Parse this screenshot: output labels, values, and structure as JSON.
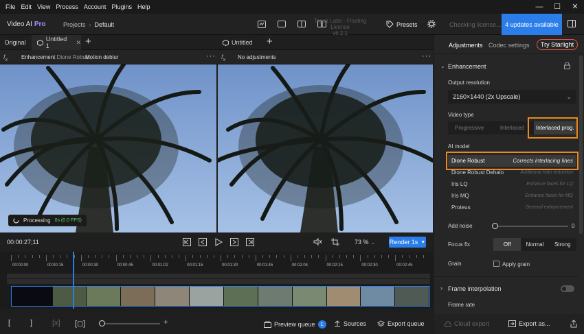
{
  "menu": [
    "File",
    "Edit",
    "View",
    "Process",
    "Account",
    "Plugins",
    "Help"
  ],
  "window_controls": [
    "—",
    "☐",
    "✕"
  ],
  "header": {
    "brand_name": "Video AI",
    "brand_tier": "Pro",
    "projects_label": "Projects",
    "breadcrumb_current": "Default",
    "license_line1": "Topaz Labs - Floating License",
    "license_line2": "v6.2.1",
    "presets_label": "Presets",
    "checking_label": "Checking license...",
    "updates_label": "4 updates available"
  },
  "tabs": {
    "original_label": "Original",
    "untitled1_label": "Untitled 1",
    "untitled_label": "Untitled"
  },
  "subbar": {
    "enhancement_label": "Enhancement",
    "enhancement_model": "Dione Robust",
    "motion_label": "Motion deblur",
    "no_adjustments": "No adjustments"
  },
  "processing": {
    "label": "Processing",
    "fps": "0s (0.0 FPS)"
  },
  "transport": {
    "timecode": "00:00:27;11",
    "zoom": "73 %",
    "render_label": "Render 1s"
  },
  "timeline": {
    "ticks": [
      "00:00:00",
      "00:00:15",
      "00:00:30",
      "00:00:45",
      "00:01:02",
      "00:01:15",
      "00:01:30",
      "00:01:45",
      "00:02:04",
      "00:02:15",
      "00:02:30",
      "00:02:45"
    ]
  },
  "bottombar": {
    "preview_queue_label": "Preview queue",
    "preview_queue_count": "1",
    "sources_label": "Sources",
    "export_queue_label": "Export queue",
    "cloud_export_label": "Cloud export",
    "export_as_label": "Export as..."
  },
  "rpanel": {
    "tab_adjustments": "Adjustments",
    "tab_codec": "Codec settings",
    "try_starlight": "Try Starlight",
    "enhancement_title": "Enhancement",
    "output_resolution_label": "Output resolution",
    "output_resolution_value": "2160×1440 (2x Upscale)",
    "video_type_label": "Video type",
    "video_types": [
      "Progressive",
      "Interlaced",
      "Interlaced prog."
    ],
    "ai_model_label": "AI model",
    "models": [
      {
        "name": "Dione Robust",
        "desc": "Corrects interlacing lines"
      },
      {
        "name": "Dione Robust Dehalo",
        "desc": "Additional halo reduction"
      },
      {
        "name": "Iris LQ",
        "desc": "Enhance faces for LQ"
      },
      {
        "name": "Iris MQ",
        "desc": "Enhance faces for MQ"
      },
      {
        "name": "Proteus",
        "desc": "General enhancement"
      }
    ],
    "add_noise_label": "Add noise",
    "add_noise_value": "0",
    "focus_fix_label": "Focus fix",
    "focus_fix_options": [
      "Off",
      "Normal",
      "Strong"
    ],
    "grain_label": "Grain",
    "apply_grain_label": "Apply grain",
    "frame_interp_label": "Frame interpolation",
    "frame_rate_label": "Frame rate"
  }
}
